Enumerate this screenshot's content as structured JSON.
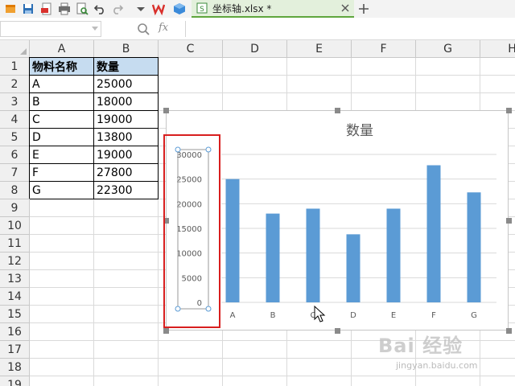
{
  "tab": {
    "filename": "坐标轴.xlsx *"
  },
  "toolbar": {
    "icons": [
      "app-logo-icon",
      "save-icon",
      "export-pdf-icon",
      "print-icon",
      "print-preview-icon",
      "undo-icon",
      "redo-icon",
      "more-dropdown-icon",
      "wps-logo-icon",
      "cloud-cube-icon"
    ]
  },
  "formula_bar": {
    "namebox_value": "",
    "fx_label": "fx",
    "formula_value": ""
  },
  "grid": {
    "columns": [
      "A",
      "B",
      "C",
      "D",
      "E",
      "F",
      "G",
      "H"
    ],
    "rows": [
      "1",
      "2",
      "3",
      "4",
      "5",
      "6",
      "7",
      "8",
      "9",
      "10",
      "11",
      "12",
      "13",
      "14",
      "15",
      "16",
      "17",
      "18",
      "19"
    ]
  },
  "table": {
    "headers": [
      "物料名称",
      "数量"
    ],
    "rows": [
      [
        "A",
        "25000"
      ],
      [
        "B",
        "18000"
      ],
      [
        "C",
        "19000"
      ],
      [
        "D",
        "13800"
      ],
      [
        "E",
        "19000"
      ],
      [
        "F",
        "27800"
      ],
      [
        "G",
        "22300"
      ]
    ]
  },
  "chart_data": {
    "type": "bar",
    "title": "数量",
    "categories": [
      "A",
      "B",
      "C",
      "D",
      "E",
      "F",
      "G"
    ],
    "values": [
      25000,
      18000,
      19000,
      13800,
      19000,
      27800,
      22300
    ],
    "y_ticks": [
      "30000",
      "25000",
      "20000",
      "15000",
      "10000",
      "5000",
      "0"
    ],
    "ylim": [
      0,
      30000
    ],
    "grid": true,
    "legend": "none",
    "bar_color": "#5b9bd5"
  },
  "watermark": {
    "brand": "Bai 经验",
    "url": "jingyan.baidu.com"
  },
  "colors": {
    "header_fill": "#c6dcf0",
    "highlight_box": "#d81f1f",
    "tab_fill": "#e3f0dc"
  }
}
